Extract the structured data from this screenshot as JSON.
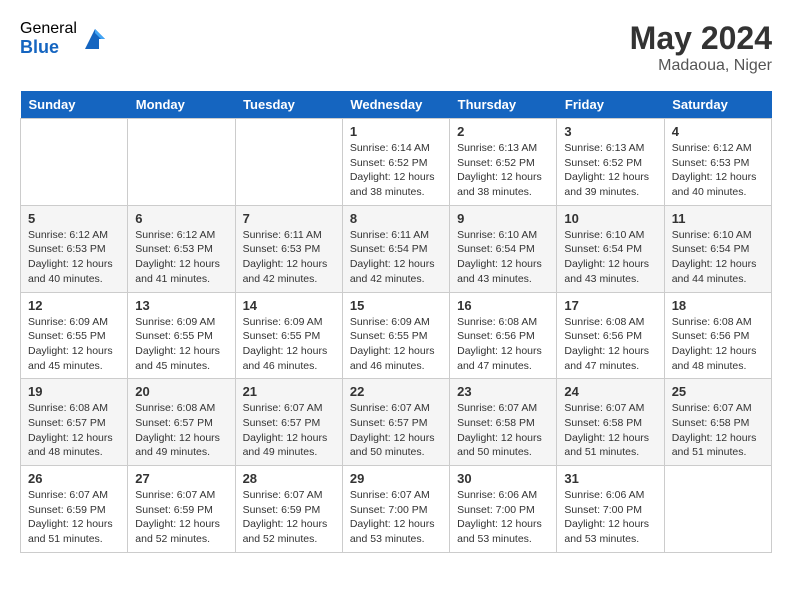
{
  "logo": {
    "general": "General",
    "blue": "Blue"
  },
  "title": {
    "month_year": "May 2024",
    "location": "Madaoua, Niger"
  },
  "days_of_week": [
    "Sunday",
    "Monday",
    "Tuesday",
    "Wednesday",
    "Thursday",
    "Friday",
    "Saturday"
  ],
  "weeks": [
    [
      {
        "day": null
      },
      {
        "day": null
      },
      {
        "day": null
      },
      {
        "day": 1,
        "sunrise": "6:14 AM",
        "sunset": "6:52 PM",
        "daylight": "12 hours and 38 minutes."
      },
      {
        "day": 2,
        "sunrise": "6:13 AM",
        "sunset": "6:52 PM",
        "daylight": "12 hours and 38 minutes."
      },
      {
        "day": 3,
        "sunrise": "6:13 AM",
        "sunset": "6:52 PM",
        "daylight": "12 hours and 39 minutes."
      },
      {
        "day": 4,
        "sunrise": "6:12 AM",
        "sunset": "6:53 PM",
        "daylight": "12 hours and 40 minutes."
      }
    ],
    [
      {
        "day": 5,
        "sunrise": "6:12 AM",
        "sunset": "6:53 PM",
        "daylight": "12 hours and 40 minutes."
      },
      {
        "day": 6,
        "sunrise": "6:12 AM",
        "sunset": "6:53 PM",
        "daylight": "12 hours and 41 minutes."
      },
      {
        "day": 7,
        "sunrise": "6:11 AM",
        "sunset": "6:53 PM",
        "daylight": "12 hours and 42 minutes."
      },
      {
        "day": 8,
        "sunrise": "6:11 AM",
        "sunset": "6:54 PM",
        "daylight": "12 hours and 42 minutes."
      },
      {
        "day": 9,
        "sunrise": "6:10 AM",
        "sunset": "6:54 PM",
        "daylight": "12 hours and 43 minutes."
      },
      {
        "day": 10,
        "sunrise": "6:10 AM",
        "sunset": "6:54 PM",
        "daylight": "12 hours and 43 minutes."
      },
      {
        "day": 11,
        "sunrise": "6:10 AM",
        "sunset": "6:54 PM",
        "daylight": "12 hours and 44 minutes."
      }
    ],
    [
      {
        "day": 12,
        "sunrise": "6:09 AM",
        "sunset": "6:55 PM",
        "daylight": "12 hours and 45 minutes."
      },
      {
        "day": 13,
        "sunrise": "6:09 AM",
        "sunset": "6:55 PM",
        "daylight": "12 hours and 45 minutes."
      },
      {
        "day": 14,
        "sunrise": "6:09 AM",
        "sunset": "6:55 PM",
        "daylight": "12 hours and 46 minutes."
      },
      {
        "day": 15,
        "sunrise": "6:09 AM",
        "sunset": "6:55 PM",
        "daylight": "12 hours and 46 minutes."
      },
      {
        "day": 16,
        "sunrise": "6:08 AM",
        "sunset": "6:56 PM",
        "daylight": "12 hours and 47 minutes."
      },
      {
        "day": 17,
        "sunrise": "6:08 AM",
        "sunset": "6:56 PM",
        "daylight": "12 hours and 47 minutes."
      },
      {
        "day": 18,
        "sunrise": "6:08 AM",
        "sunset": "6:56 PM",
        "daylight": "12 hours and 48 minutes."
      }
    ],
    [
      {
        "day": 19,
        "sunrise": "6:08 AM",
        "sunset": "6:57 PM",
        "daylight": "12 hours and 48 minutes."
      },
      {
        "day": 20,
        "sunrise": "6:08 AM",
        "sunset": "6:57 PM",
        "daylight": "12 hours and 49 minutes."
      },
      {
        "day": 21,
        "sunrise": "6:07 AM",
        "sunset": "6:57 PM",
        "daylight": "12 hours and 49 minutes."
      },
      {
        "day": 22,
        "sunrise": "6:07 AM",
        "sunset": "6:57 PM",
        "daylight": "12 hours and 50 minutes."
      },
      {
        "day": 23,
        "sunrise": "6:07 AM",
        "sunset": "6:58 PM",
        "daylight": "12 hours and 50 minutes."
      },
      {
        "day": 24,
        "sunrise": "6:07 AM",
        "sunset": "6:58 PM",
        "daylight": "12 hours and 51 minutes."
      },
      {
        "day": 25,
        "sunrise": "6:07 AM",
        "sunset": "6:58 PM",
        "daylight": "12 hours and 51 minutes."
      }
    ],
    [
      {
        "day": 26,
        "sunrise": "6:07 AM",
        "sunset": "6:59 PM",
        "daylight": "12 hours and 51 minutes."
      },
      {
        "day": 27,
        "sunrise": "6:07 AM",
        "sunset": "6:59 PM",
        "daylight": "12 hours and 52 minutes."
      },
      {
        "day": 28,
        "sunrise": "6:07 AM",
        "sunset": "6:59 PM",
        "daylight": "12 hours and 52 minutes."
      },
      {
        "day": 29,
        "sunrise": "6:07 AM",
        "sunset": "7:00 PM",
        "daylight": "12 hours and 53 minutes."
      },
      {
        "day": 30,
        "sunrise": "6:06 AM",
        "sunset": "7:00 PM",
        "daylight": "12 hours and 53 minutes."
      },
      {
        "day": 31,
        "sunrise": "6:06 AM",
        "sunset": "7:00 PM",
        "daylight": "12 hours and 53 minutes."
      },
      {
        "day": null
      }
    ]
  ]
}
